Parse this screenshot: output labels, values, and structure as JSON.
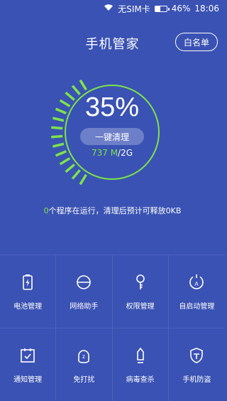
{
  "status_bar": {
    "sim": "无SIM卡",
    "battery": "46%",
    "battery_level": 0.46,
    "time": "18:06"
  },
  "header": {
    "title": "手机管家",
    "whitelist_label": "白名单"
  },
  "gauge": {
    "percent": "35%",
    "level": 0.35,
    "clean_label": "一键清理",
    "memory_used": "737 M",
    "memory_total": "/2G",
    "accent": "#7de34b"
  },
  "run_info": {
    "count": "0",
    "text": "个程序在运行，清理后预计可释放0KB"
  },
  "tools": [
    {
      "label": "电池管理",
      "icon": "battery-icon"
    },
    {
      "label": "网络助手",
      "icon": "network-icon"
    },
    {
      "label": "权限管理",
      "icon": "key-icon"
    },
    {
      "label": "自启动管理",
      "icon": "autostart-icon"
    },
    {
      "label": "通知管理",
      "icon": "notification-icon"
    },
    {
      "label": "免打扰",
      "icon": "do-not-disturb-icon"
    },
    {
      "label": "病毒查杀",
      "icon": "virus-scan-icon"
    },
    {
      "label": "手机防盗",
      "icon": "anti-theft-icon"
    }
  ]
}
